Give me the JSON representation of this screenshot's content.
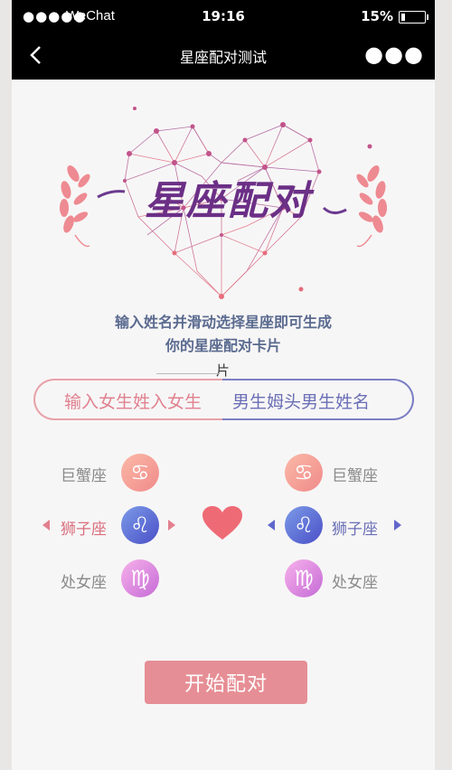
{
  "status_bar": {
    "signal": "●●●●●",
    "carrier": "WeChat",
    "time": "19:16",
    "battery": "15%"
  },
  "nav": {
    "title": "星座配对测试"
  },
  "hero": {
    "title": "星座配对"
  },
  "intro": {
    "line1": "输入姓名并滑动选择星座即可生成",
    "line2": "你的星座配对卡片",
    "overflow": "片"
  },
  "inputs": {
    "female_text": "输入女生姓入女生",
    "male_text": "男生姆头男生姓名"
  },
  "zodiac_female": [
    {
      "label": "巨蟹座",
      "symbol": "♋"
    },
    {
      "label": "狮子座",
      "symbol": "♌"
    },
    {
      "label": "处女座",
      "symbol": "♍"
    }
  ],
  "zodiac_male": [
    {
      "label": "巨蟹座",
      "symbol": "♋"
    },
    {
      "label": "狮子座",
      "symbol": "♌"
    },
    {
      "label": "处女座",
      "symbol": "♍"
    }
  ],
  "start_button": "开始配对",
  "colors": {
    "accent_pink": "#e68e95",
    "accent_blue": "#6a6fb6",
    "heart": "#ee6b76"
  }
}
